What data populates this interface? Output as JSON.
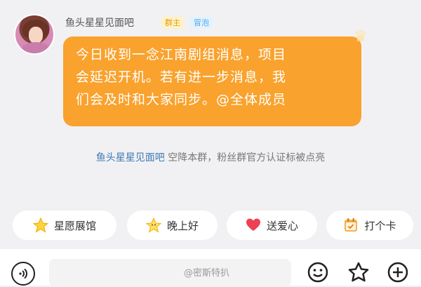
{
  "sender": {
    "name": "鱼头星星见面吧",
    "owner_badge": "群主",
    "bubble_badge": "冒泡"
  },
  "message": {
    "lines": [
      "今日收到一念江南剧组消息，项目",
      "会延迟开机。若有进一步消息，我",
      "们会及时和大家同步。@全体成员"
    ]
  },
  "system": {
    "name": "鱼头星星见面吧",
    "text": " 空降本群，粉丝群官方认证标被点亮"
  },
  "quick_actions": [
    {
      "label": "星愿展馆",
      "icon": "star-icon"
    },
    {
      "label": "晚上好",
      "icon": "smiling-star-icon"
    },
    {
      "label": "送爱心",
      "icon": "heart-icon"
    },
    {
      "label": "打个卡",
      "icon": "checkin-card-icon"
    }
  ],
  "watermark": "@密斯特扒",
  "colors": {
    "bubble": "#f9a22d",
    "background": "#f1f1f3",
    "system_name": "#3f79b6"
  }
}
